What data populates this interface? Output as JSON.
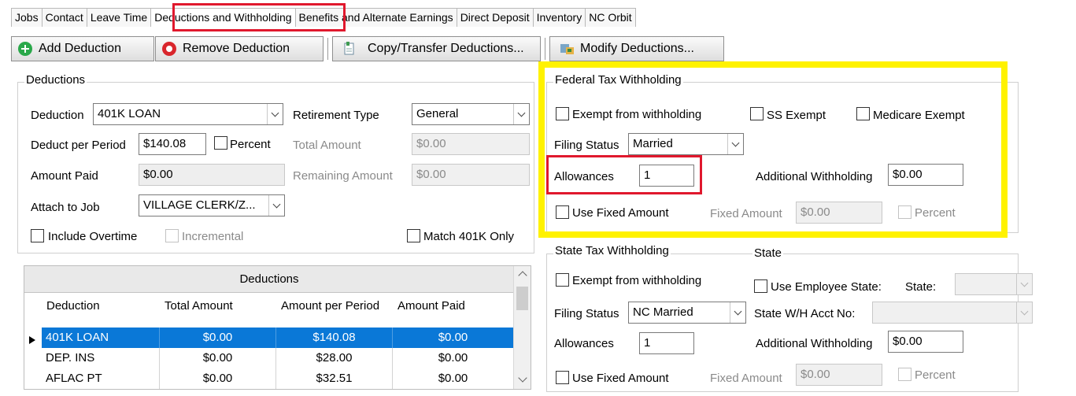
{
  "tabs": [
    "Jobs",
    "Contact",
    "Leave Time",
    "Deductions and Withholding",
    "Benefits and Alternate Earnings",
    "Direct Deposit",
    "Inventory",
    "NC Orbit"
  ],
  "toolbar": {
    "add": "Add Deduction",
    "remove": "Remove Deduction",
    "copy": "Copy/Transfer Deductions...",
    "modify": "Modify Deductions..."
  },
  "deductions": {
    "title": "Deductions",
    "deduction_label": "Deduction",
    "deduction_value": "401K LOAN",
    "retirement_type_label": "Retirement Type",
    "retirement_type_value": "General",
    "deduct_per_period_label": "Deduct per Period",
    "deduct_per_period_value": "$140.08",
    "percent_label": "Percent",
    "total_amount_label": "Total Amount",
    "total_amount_value": "$0.00",
    "amount_paid_label": "Amount Paid",
    "amount_paid_value": "$0.00",
    "remaining_amount_label": "Remaining Amount",
    "remaining_amount_value": "$0.00",
    "attach_to_job_label": "Attach to Job",
    "attach_to_job_value": "VILLAGE CLERK/Z...",
    "include_overtime_label": "Include Overtime",
    "incremental_label": "Incremental",
    "match_401k_label": "Match 401K Only"
  },
  "grid": {
    "title": "Deductions",
    "columns": [
      "Deduction",
      "Total Amount",
      "Amount per Period",
      "Amount Paid"
    ],
    "rows": [
      [
        "401K LOAN",
        "$0.00",
        "$140.08",
        "$0.00"
      ],
      [
        "DEP. INS",
        "$0.00",
        "$28.00",
        "$0.00"
      ],
      [
        "AFLAC PT",
        "$0.00",
        "$32.51",
        "$0.00"
      ]
    ]
  },
  "federal": {
    "title": "Federal Tax Withholding",
    "exempt_label": "Exempt from withholding",
    "ss_exempt_label": "SS Exempt",
    "medicare_exempt_label": "Medicare Exempt",
    "filing_status_label": "Filing Status",
    "filing_status_value": "Married",
    "allowances_label": "Allowances",
    "allowances_value": "1",
    "additional_withholding_label": "Additional Withholding",
    "additional_withholding_value": "$0.00",
    "use_fixed_amount_label": "Use Fixed Amount",
    "fixed_amount_label": "Fixed Amount",
    "fixed_amount_value": "$0.00",
    "percent_label": "Percent"
  },
  "state": {
    "title": "State Tax Withholding",
    "state_group_title": "State",
    "exempt_label": "Exempt from withholding",
    "use_employee_state_label": "Use Employee State:",
    "state_label": "State:",
    "state_value": "",
    "filing_status_label": "Filing Status",
    "filing_status_value": "NC Married",
    "state_wh_acct_label": "State W/H Acct No:",
    "state_wh_acct_value": "",
    "allowances_label": "Allowances",
    "allowances_value": "1",
    "additional_withholding_label": "Additional Withholding",
    "additional_withholding_value": "$0.00",
    "use_fixed_amount_label": "Use Fixed Amount",
    "fixed_amount_label": "Fixed Amount",
    "fixed_amount_value": "$0.00",
    "percent_label": "Percent"
  },
  "colors": {
    "selection": "#0a78d7",
    "highlight_red": "#e0182d",
    "highlight_yellow": "#fff200",
    "add_icon": "#2aa84a",
    "remove_icon": "#d9262c"
  },
  "icons": [
    "add-circle-icon",
    "remove-circle-icon",
    "copy-transfer-icon",
    "modify-deductions-icon",
    "row-pointer-icon"
  ]
}
